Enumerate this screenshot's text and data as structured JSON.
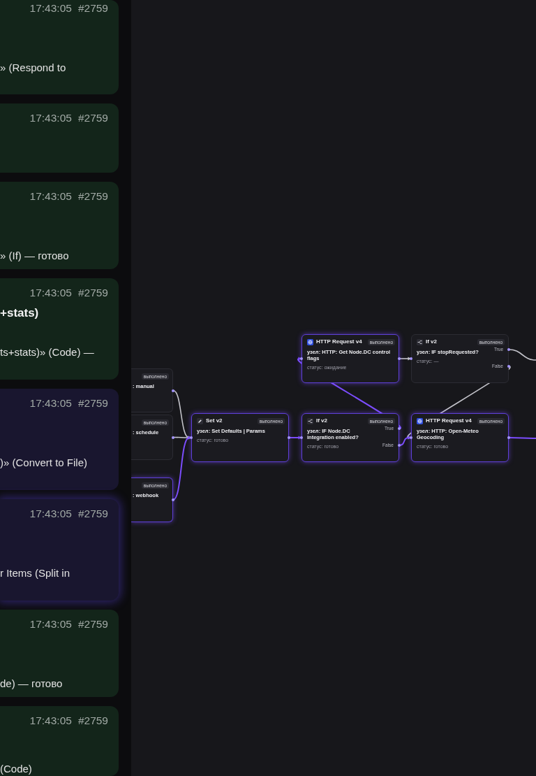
{
  "cards": [
    {
      "time": "17:43:05",
      "run": "#2759",
      "description": "» (Respond to",
      "color": "#13251a",
      "selected": false
    },
    {
      "time": "17:43:05",
      "run": "#2759",
      "color": "#13251a",
      "selected": false
    },
    {
      "time": "17:43:05",
      "run": "#2759",
      "description": "» (If) — готово",
      "color": "#13251a",
      "selected": false
    },
    {
      "time": "17:43:05",
      "run": "#2759",
      "title": "+stats)",
      "description": "ts+stats)» (Code) —",
      "color": "#13251a",
      "selected": false
    },
    {
      "time": "17:43:05",
      "run": "#2759",
      "description": ")» (Convert to File)",
      "color": "#19162f",
      "selected": false
    },
    {
      "time": "17:43:05",
      "run": "#2759",
      "description": "r Items (Split in",
      "color": "#19162f",
      "selected": true
    },
    {
      "time": "17:43:05",
      "run": "#2759",
      "description": "de) — готово",
      "color": "#13251a",
      "selected": false
    },
    {
      "time": "17:43:05",
      "run": "#2759",
      "description": "(Code)",
      "color": "#13251a",
      "selected": false
    }
  ],
  "nodes": [
    {
      "kind": "http",
      "title": "HTTP Request v4",
      "badge": "выполнено",
      "line": "узел: HTTP: Get Node.DC control flags",
      "status": "статус: ожидание",
      "active": true
    },
    {
      "kind": "if",
      "title": "If v2",
      "badge": "выполнено",
      "line": "узел: IF stopRequested?",
      "status": "статус: —",
      "true_label": "True",
      "false_label": "False",
      "active": false
    },
    {
      "kind": "trigger",
      "badge": "выполнено",
      "line": ": manual",
      "active": false
    },
    {
      "kind": "trigger",
      "badge": "выполнено",
      "line": ": schedule",
      "active": false
    },
    {
      "kind": "set",
      "title": "Set v2",
      "badge": "выполнено",
      "line": "узел: Set Defaults | Params",
      "status": "статус: готово",
      "active": true
    },
    {
      "kind": "if",
      "title": "If v2",
      "badge": "выполнено",
      "line": "узел: IF Node.DC integration enabled?",
      "status": "статус: готово",
      "true_label": "True",
      "false_label": "False",
      "active": true
    },
    {
      "kind": "http",
      "title": "HTTP Request v4",
      "badge": "выполнено",
      "line": "узел: HTTP: Open-Meteo Geocoding",
      "status": "статус: готово",
      "active": true
    },
    {
      "kind": "trigger",
      "badge": "выполнено",
      "line": ": webhook",
      "active": true
    }
  ],
  "connections": [
    {
      "active": false
    },
    {
      "active": false
    },
    {
      "active": true
    },
    {
      "active": false
    },
    {
      "active": false
    },
    {
      "active": false
    },
    {
      "active": true
    },
    {
      "active": true
    },
    {
      "active": true
    },
    {
      "active": true
    }
  ]
}
